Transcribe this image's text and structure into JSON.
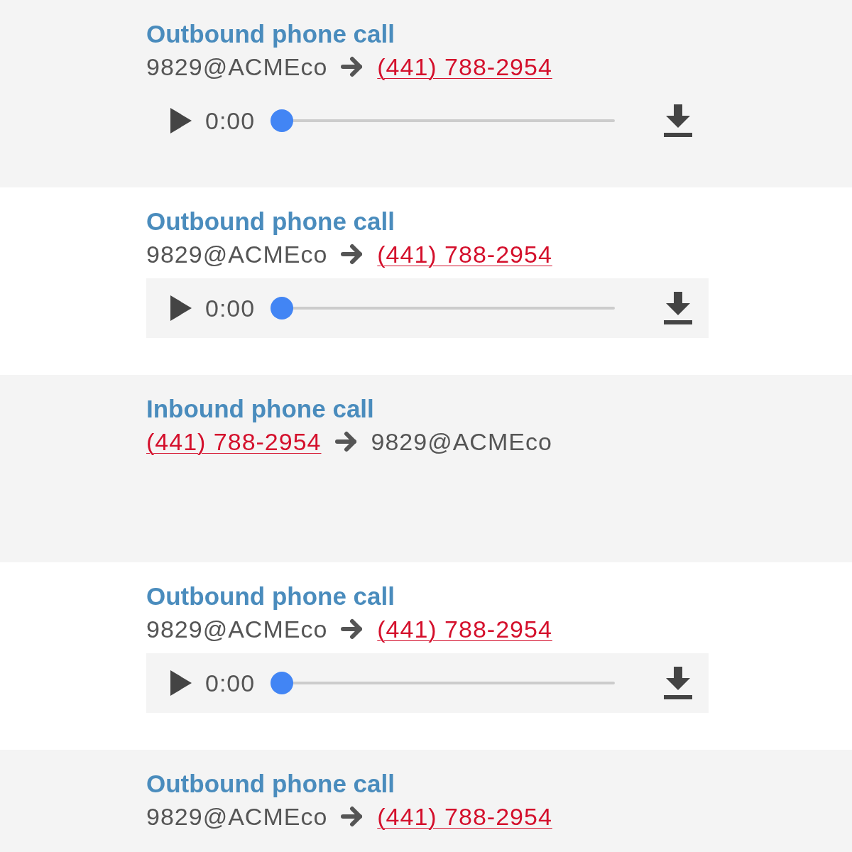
{
  "calls": [
    {
      "title": "Outbound phone call",
      "parties": [
        {
          "kind": "extension",
          "text": "9829@ACMEco"
        },
        {
          "kind": "phone",
          "text": "(441) 788-2954"
        }
      ],
      "player": {
        "time": "0:00",
        "level": 0
      }
    },
    {
      "title": "Outbound phone call",
      "parties": [
        {
          "kind": "extension",
          "text": "9829@ACMEco"
        },
        {
          "kind": "phone",
          "text": "(441) 788-2954"
        }
      ],
      "player": {
        "time": "0:00",
        "level": 0
      }
    },
    {
      "title": "Inbound phone call",
      "parties": [
        {
          "kind": "phone",
          "text": "(441) 788-2954"
        },
        {
          "kind": "extension",
          "text": "9829@ACMEco"
        }
      ]
    },
    {
      "title": "Outbound phone call",
      "parties": [
        {
          "kind": "extension",
          "text": "9829@ACMEco"
        },
        {
          "kind": "phone",
          "text": "(441) 788-2954"
        }
      ],
      "player": {
        "time": "0:00",
        "level": 0
      }
    },
    {
      "title": "Outbound phone call",
      "parties": [
        {
          "kind": "extension",
          "text": "9829@ACMEco"
        },
        {
          "kind": "phone",
          "text": "(441) 788-2954"
        }
      ]
    }
  ]
}
